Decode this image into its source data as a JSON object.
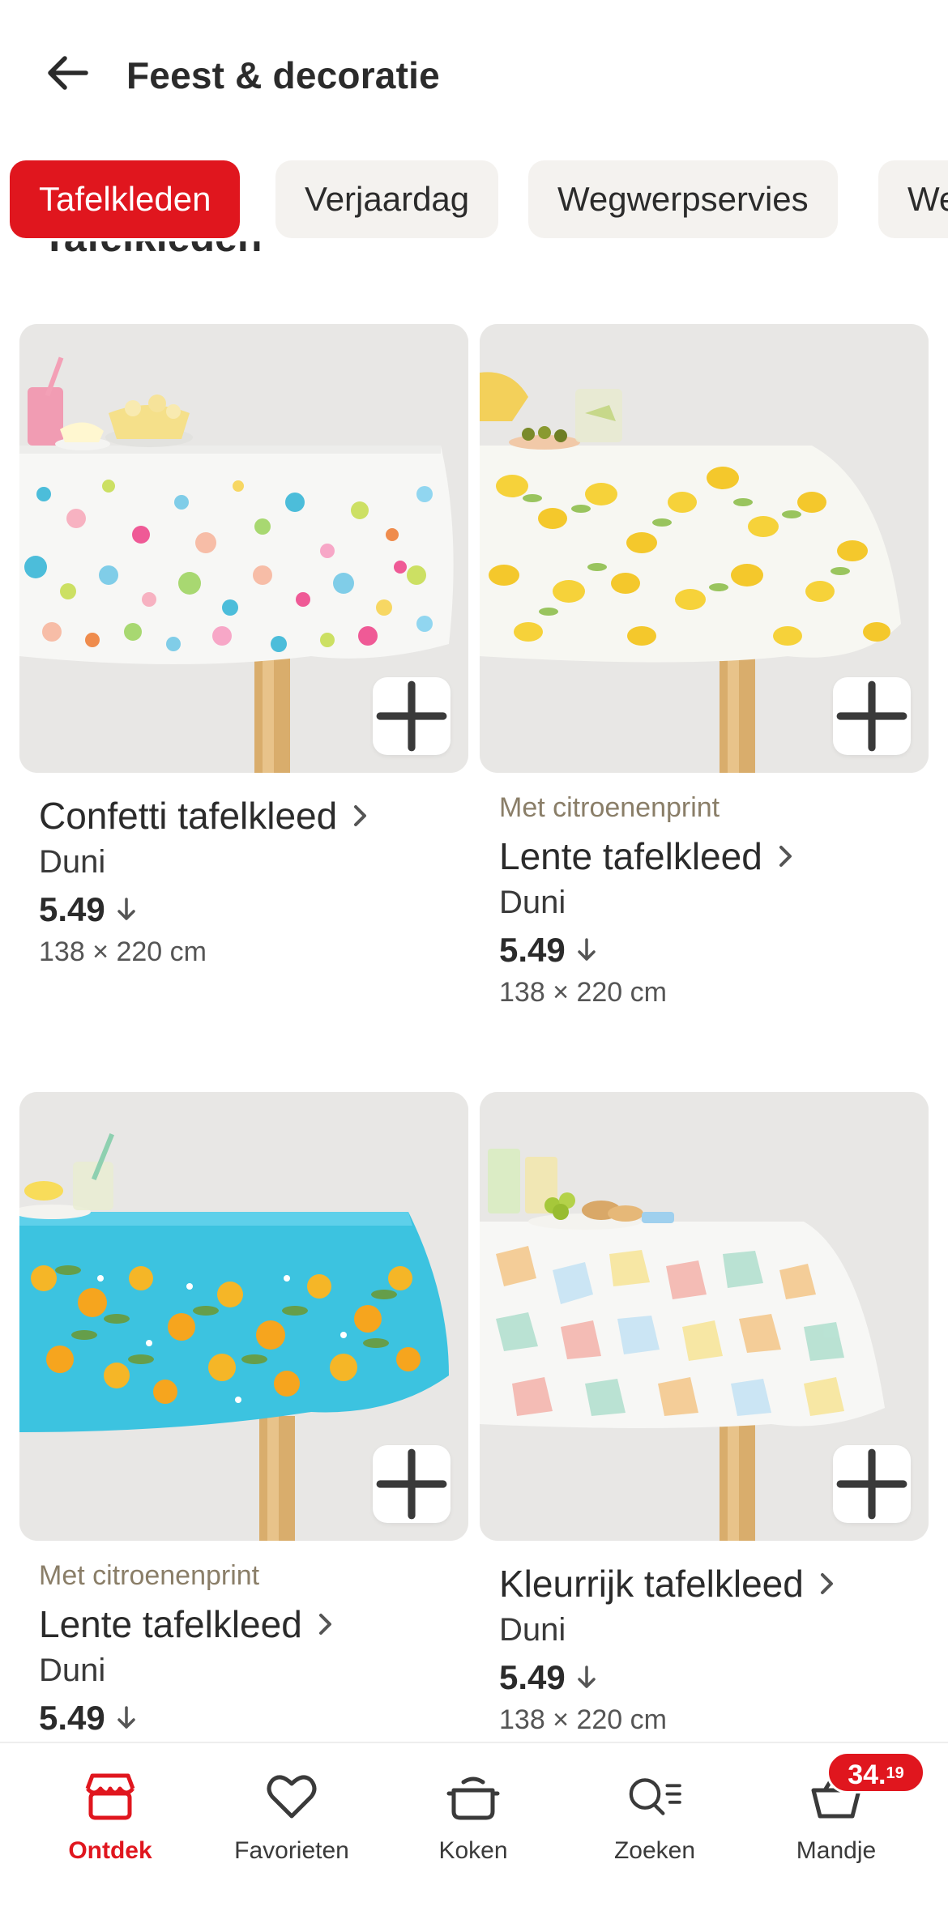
{
  "header": {
    "title": "Feest & decoratie"
  },
  "chips": [
    {
      "label": "Tafelkleden",
      "active": true
    },
    {
      "label": "Verjaardag",
      "active": false
    },
    {
      "label": "Wegwerpservies",
      "active": false
    },
    {
      "label": "Wegwerp",
      "active": false
    }
  ],
  "section": {
    "title": "Tafelkleden"
  },
  "products": [
    {
      "subtitle": "",
      "name": "Confetti tafelkleed",
      "brand": "Duni",
      "price": "5.49",
      "size": "138 × 220 cm",
      "image": "confetti-tablecloth"
    },
    {
      "subtitle": "Met citroenenprint",
      "name": "Lente tafelkleed",
      "brand": "Duni",
      "price": "5.49",
      "size": "138 × 220 cm",
      "image": "lemon-tablecloth-white"
    },
    {
      "subtitle": "Met citroenenprint",
      "name": "Lente tafelkleed",
      "brand": "Duni",
      "price": "5.49",
      "size": "",
      "image": "lemon-tablecloth-blue"
    },
    {
      "subtitle": "",
      "name": "Kleurrijk tafelkleed",
      "brand": "Duni",
      "price": "5.49",
      "size": "138 × 220 cm",
      "image": "colorful-tablecloth"
    }
  ],
  "tabbar": {
    "items": [
      {
        "label": "Ontdek",
        "icon": "store-icon",
        "active": true
      },
      {
        "label": "Favorieten",
        "icon": "heart-icon",
        "active": false
      },
      {
        "label": "Koken",
        "icon": "pot-icon",
        "active": false
      },
      {
        "label": "Zoeken",
        "icon": "search-list-icon",
        "active": false
      },
      {
        "label": "Mandje",
        "icon": "basket-icon",
        "active": false
      }
    ],
    "cart_total_main": "34.",
    "cart_total_cents": "19"
  },
  "colors": {
    "accent": "#e0161e",
    "chip_bg": "#f4f2ef",
    "subtitle": "#8a7e68"
  }
}
